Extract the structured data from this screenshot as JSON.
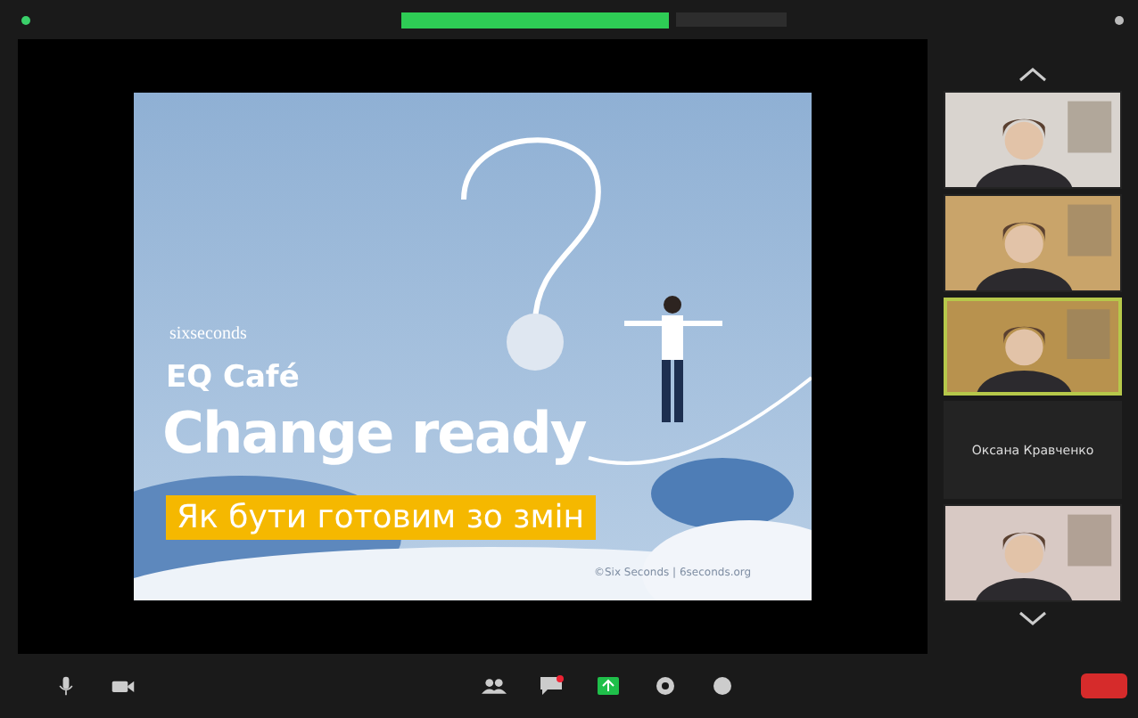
{
  "slide": {
    "logo": "sixseconds",
    "subtitle": "EQ Café",
    "title": "Change ready",
    "banner": "Як бути готовим зо змін",
    "footer": "©Six Seconds | 6seconds.org"
  },
  "participants": [
    {
      "kind": "video",
      "speaking": false
    },
    {
      "kind": "video",
      "speaking": false
    },
    {
      "kind": "video",
      "speaking": true
    },
    {
      "kind": "name",
      "speaking": false,
      "name": "Оксана Кравченко"
    },
    {
      "kind": "video",
      "speaking": false
    }
  ]
}
